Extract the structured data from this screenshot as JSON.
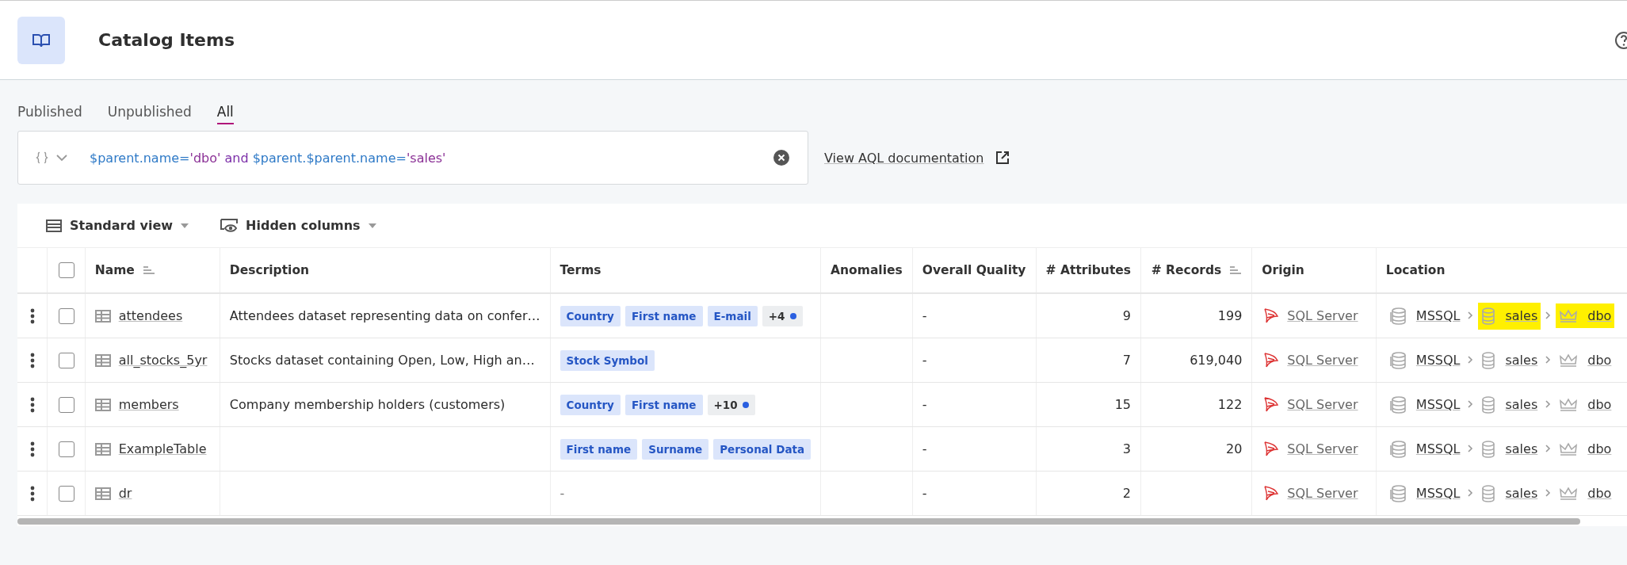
{
  "header": {
    "title": "Catalog Items"
  },
  "tabs": [
    {
      "label": "Published",
      "selected": false
    },
    {
      "label": "Unpublished",
      "selected": false
    },
    {
      "label": "All",
      "selected": true
    }
  ],
  "query": {
    "tokens": [
      {
        "text": "$parent.name=",
        "kind": "ident"
      },
      {
        "text": "'dbo'",
        "kind": "string"
      },
      {
        "text": " and ",
        "kind": "keyword"
      },
      {
        "text": "$parent.$parent.name=",
        "kind": "ident"
      },
      {
        "text": "'sales'",
        "kind": "string"
      }
    ]
  },
  "doc_link": "View AQL documentation",
  "toolbar": {
    "view": "Standard view",
    "columns": "Hidden columns"
  },
  "table": {
    "select_all_checked": false,
    "columns": [
      {
        "label": "Name",
        "sortable": true
      },
      {
        "label": "Description",
        "sortable": false
      },
      {
        "label": "Terms",
        "sortable": false
      },
      {
        "label": "Anomalies",
        "sortable": false
      },
      {
        "label": "Overall Quality",
        "sortable": false
      },
      {
        "label": "# Attributes",
        "sortable": false
      },
      {
        "label": "# Records",
        "sortable": true
      },
      {
        "label": "Origin",
        "sortable": false
      },
      {
        "label": "Location",
        "sortable": false
      }
    ],
    "rows": [
      {
        "checked": false,
        "name": "attendees",
        "description": "Attendees dataset representing data on confer…",
        "terms": [
          {
            "text": "Country",
            "kind": "term"
          },
          {
            "text": "First name",
            "kind": "term"
          },
          {
            "text": "E-mail",
            "kind": "term"
          },
          {
            "text": "+4",
            "kind": "more"
          }
        ],
        "quality": "-",
        "attributes": "9",
        "records": "199",
        "origin": "SQL Server",
        "location": [
          {
            "text": "MSSQL",
            "kind": "server",
            "highlighted": false
          },
          {
            "text": "sales",
            "kind": "database",
            "highlighted": true
          },
          {
            "text": "dbo",
            "kind": "schema",
            "highlighted": true
          }
        ]
      },
      {
        "checked": false,
        "name": "all_stocks_5yr",
        "description": "Stocks dataset containing Open, Low, High an…",
        "terms": [
          {
            "text": "Stock Symbol",
            "kind": "term"
          }
        ],
        "quality": "-",
        "attributes": "7",
        "records": "619,040",
        "origin": "SQL Server",
        "location": [
          {
            "text": "MSSQL",
            "kind": "server",
            "highlighted": false
          },
          {
            "text": "sales",
            "kind": "database",
            "highlighted": false
          },
          {
            "text": "dbo",
            "kind": "schema",
            "highlighted": false
          }
        ]
      },
      {
        "checked": false,
        "name": "members",
        "description": "Company membership holders (customers)",
        "terms": [
          {
            "text": "Country",
            "kind": "term"
          },
          {
            "text": "First name",
            "kind": "term"
          },
          {
            "text": "+10",
            "kind": "more"
          }
        ],
        "quality": "-",
        "attributes": "15",
        "records": "122",
        "origin": "SQL Server",
        "location": [
          {
            "text": "MSSQL",
            "kind": "server",
            "highlighted": false
          },
          {
            "text": "sales",
            "kind": "database",
            "highlighted": false
          },
          {
            "text": "dbo",
            "kind": "schema",
            "highlighted": false
          }
        ]
      },
      {
        "checked": false,
        "name": "ExampleTable",
        "terms": [
          {
            "text": "First name",
            "kind": "term"
          },
          {
            "text": "Surname",
            "kind": "term"
          },
          {
            "text": "Personal Data",
            "kind": "term"
          }
        ],
        "quality": "-",
        "attributes": "3",
        "records": "20",
        "origin": "SQL Server",
        "location": [
          {
            "text": "MSSQL",
            "kind": "server",
            "highlighted": false
          },
          {
            "text": "sales",
            "kind": "database",
            "highlighted": false
          },
          {
            "text": "dbo",
            "kind": "schema",
            "highlighted": false
          }
        ]
      },
      {
        "checked": false,
        "name": "dr",
        "terms": [],
        "terms_empty": "-",
        "quality": "-",
        "attributes": "2",
        "origin": "SQL Server",
        "location": [
          {
            "text": "MSSQL",
            "kind": "server",
            "highlighted": false
          },
          {
            "text": "sales",
            "kind": "database",
            "highlighted": false
          },
          {
            "text": "dbo",
            "kind": "schema",
            "highlighted": false
          }
        ]
      }
    ]
  }
}
